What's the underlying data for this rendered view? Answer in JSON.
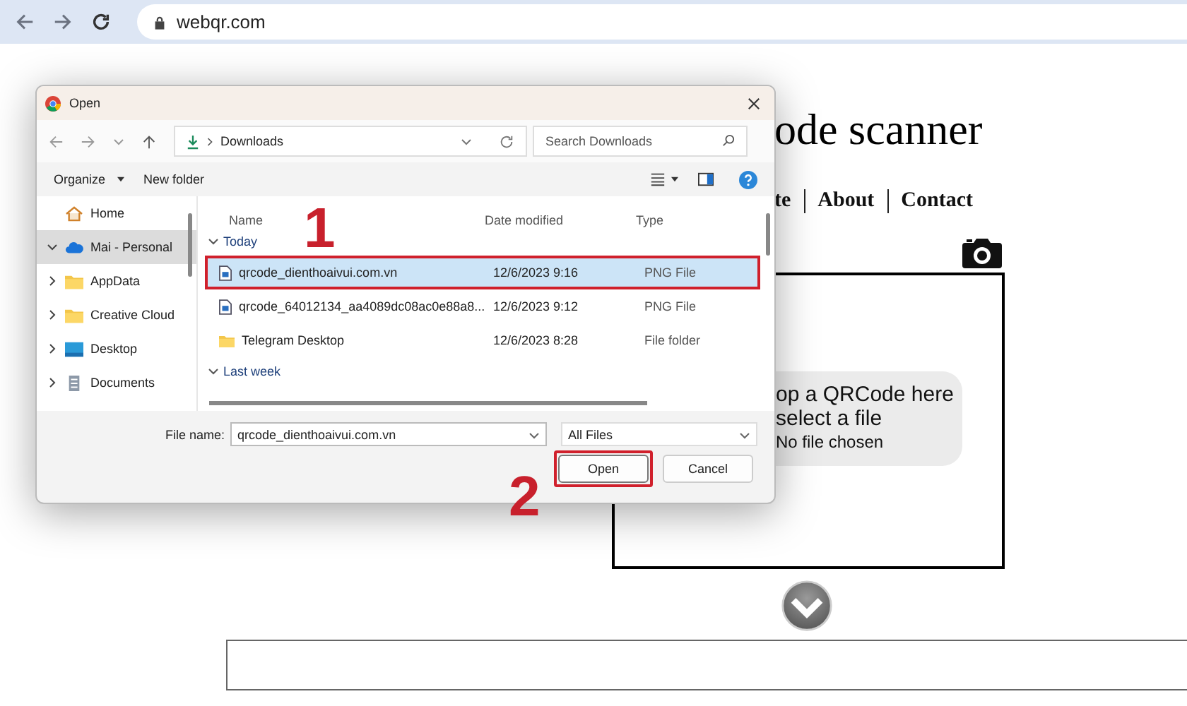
{
  "browser": {
    "url": "webqr.com"
  },
  "page": {
    "title": "ode scanner",
    "nav": [
      "te",
      "About",
      "Contact"
    ],
    "drop_zone": {
      "lines": [
        "op a QRCode here",
        "select a file"
      ],
      "status": "No file chosen"
    }
  },
  "dialog": {
    "title": "Open",
    "path": "Downloads",
    "search": {
      "placeholder": "Search Downloads"
    },
    "toolbar": [
      "Organize",
      "New folder"
    ],
    "sidebar": [
      {
        "label": "Home",
        "kind": "home",
        "expandable": false,
        "selected": false
      },
      {
        "label": "Mai - Personal",
        "kind": "cloud",
        "expandable": true,
        "expanded": true,
        "selected": true
      },
      {
        "label": "AppData",
        "kind": "folder",
        "expandable": true,
        "expanded": false,
        "selected": false
      },
      {
        "label": "Creative Cloud",
        "kind": "folder",
        "expandable": true,
        "expanded": false,
        "selected": false
      },
      {
        "label": "Desktop",
        "kind": "desktop",
        "expandable": true,
        "expanded": false,
        "selected": false
      },
      {
        "label": "Documents",
        "kind": "documents",
        "expandable": true,
        "expanded": false,
        "selected": false
      }
    ],
    "columns": [
      "Name",
      "Date modified",
      "Type"
    ],
    "groups": [
      {
        "label": "Today",
        "expanded": true,
        "rows": [
          {
            "name": "qrcode_dienthoaivui.com.vn",
            "date": "12/6/2023 9:16",
            "type": "PNG File",
            "kind": "image",
            "selected": true,
            "highlighted": true
          },
          {
            "name": "qrcode_64012134_aa4089dc08ac0e88a8...",
            "date": "12/6/2023 9:12",
            "type": "PNG File",
            "kind": "image",
            "selected": false,
            "highlighted": false
          },
          {
            "name": "Telegram Desktop",
            "date": "12/6/2023 8:28",
            "type": "File folder",
            "kind": "folder",
            "selected": false,
            "highlighted": false
          }
        ]
      },
      {
        "label": "Last week",
        "expanded": true
      }
    ],
    "file_name": {
      "label": "File name:",
      "value": "qrcode_dienthoaivui.com.vn"
    },
    "file_type": "All Files",
    "buttons": [
      {
        "label": "Open",
        "default": true,
        "highlighted": true
      },
      {
        "label": "Cancel",
        "default": false,
        "highlighted": false
      }
    ]
  },
  "annotations": [
    {
      "label": "1"
    },
    {
      "label": "2"
    }
  ]
}
